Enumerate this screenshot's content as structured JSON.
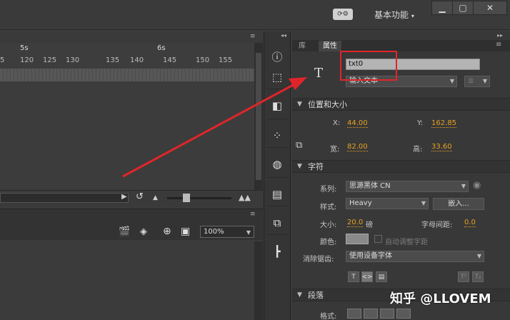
{
  "titlebar": {
    "sync_icon": "sync-settings-icon",
    "workspace_label": "基本功能",
    "minimize": "▁",
    "maximize": "▢",
    "close": "✕"
  },
  "timeline": {
    "ruler_labels": [
      "5",
      "120",
      "125",
      "130",
      "135",
      "140",
      "145",
      "150",
      "155"
    ],
    "second_markers": [
      "5s",
      "6s"
    ],
    "zoom_value": "100%"
  },
  "tools": [
    "info-icon",
    "transform-icon",
    "library-icon",
    "motion-icon",
    "color-icon",
    "align-icon",
    "components-icon",
    "history-icon"
  ],
  "properties": {
    "tabs": [
      "库",
      "属性"
    ],
    "instance_name": "txt0",
    "text_type": "输入文本",
    "position_section": "位置和大小",
    "x_label": "X:",
    "x_value": "44.00",
    "y_label": "Y:",
    "y_value": "162.85",
    "width_label": "宽:",
    "width_value": "82.00",
    "height_label": "高:",
    "height_value": "33.60",
    "char_section": "字符",
    "family_label": "系列:",
    "family_value": "思源黑体 CN",
    "style_label": "样式:",
    "style_value": "Heavy",
    "embed_button": "嵌入...",
    "size_label": "大小:",
    "size_value": "20.0",
    "size_unit": "磅",
    "spacing_label": "字母间距:",
    "spacing_value": "0.0",
    "color_label": "颜色:",
    "autokern_label": "自动调整字距",
    "antialias_label": "消除锯齿:",
    "antialias_value": "使用设备字体",
    "para_section": "段落",
    "format_label": "格式:"
  },
  "watermark": "知乎 @LLOVEM"
}
